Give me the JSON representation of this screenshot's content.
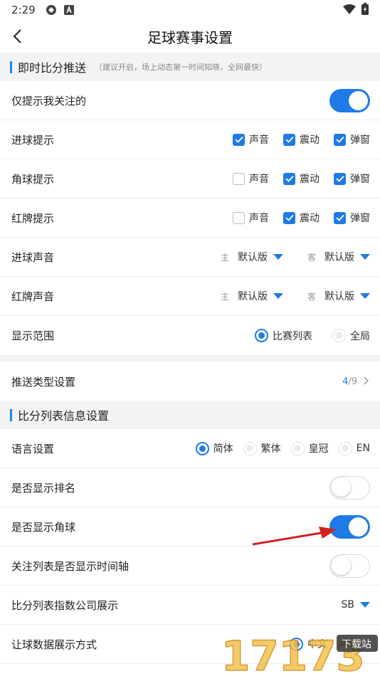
{
  "status_bar": {
    "time": "2:29"
  },
  "header": {
    "title": "足球赛事设置"
  },
  "section_push": {
    "title": "即时比分推送",
    "hint": "（建议开启，场上动态第一时间知晓，全网最快）"
  },
  "rows": {
    "only_followed": {
      "label": "仅提示我关注的",
      "toggle": "on"
    },
    "goal_alert": {
      "label": "进球提示",
      "options": [
        "声音",
        "震动",
        "弹窗"
      ],
      "checked": [
        true,
        true,
        true
      ]
    },
    "corner_alert": {
      "label": "角球提示",
      "options": [
        "声音",
        "震动",
        "弹窗"
      ],
      "checked": [
        false,
        true,
        true
      ]
    },
    "redcard_alert": {
      "label": "红牌提示",
      "options": [
        "声音",
        "震动",
        "弹窗"
      ],
      "checked": [
        false,
        true,
        true
      ]
    },
    "goal_sound": {
      "label": "进球声音",
      "home_prefix": "主",
      "home_value": "默认版",
      "away_prefix": "客",
      "away_value": "默认版"
    },
    "redcard_sound": {
      "label": "红牌声音",
      "home_prefix": "主",
      "home_value": "默认版",
      "away_prefix": "客",
      "away_value": "默认版"
    },
    "display_range": {
      "label": "显示范围",
      "options": [
        "比赛列表",
        "全局"
      ],
      "selected": "比赛列表"
    },
    "push_type": {
      "label": "推送类型设置",
      "current": "4",
      "total": "/9"
    }
  },
  "section_list": {
    "title": "比分列表信息设置"
  },
  "list_rows": {
    "language": {
      "label": "语言设置",
      "options": [
        "简体",
        "繁体",
        "皇冠",
        "EN"
      ],
      "selected": "简体"
    },
    "show_rank": {
      "label": "是否显示排名",
      "toggle": "off"
    },
    "show_corner": {
      "label": "是否显示角球",
      "toggle": "on"
    },
    "timeline": {
      "label": "关注列表是否显示时间轴",
      "toggle": "off"
    },
    "index_company": {
      "label": "比分列表指数公司展示",
      "value": "SB"
    },
    "handicap_display": {
      "label": "让球数据展示方式",
      "value": "中文"
    }
  },
  "watermark": {
    "text": "17173",
    "badge": "下载站"
  },
  "colors": {
    "accent": "#1e7be6",
    "section_bg": "#f2f3f5",
    "arrow": "#d32020"
  }
}
